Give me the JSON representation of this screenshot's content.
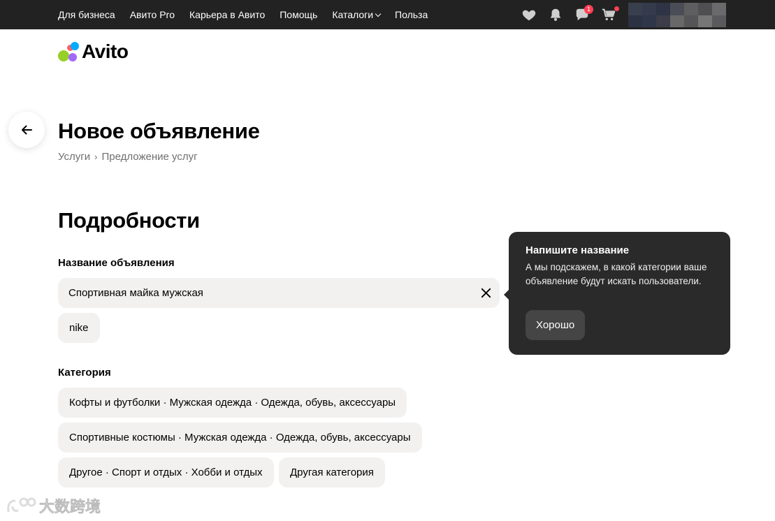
{
  "topnav": {
    "items": [
      "Для бизнеса",
      "Авито Pro",
      "Карьера в Авито",
      "Помощь",
      "Каталоги",
      "Польза"
    ],
    "messages_badge": "1",
    "icons": [
      "heart-icon",
      "bell-icon",
      "chat-icon",
      "cart-icon"
    ]
  },
  "logo": {
    "text": "Avito"
  },
  "page": {
    "title": "Новое объявление",
    "breadcrumb": [
      "Услуги",
      "Предложение услуг"
    ]
  },
  "details": {
    "section_title": "Подробности",
    "title_label": "Название объявления",
    "title_value": "Спортивная майка мужская",
    "suggestion": "nike",
    "category_label": "Категория",
    "categories": [
      "Кофты и футболки · Мужская одежда · Одежда, обувь, аксессуары",
      "Спортивные костюмы · Мужская одежда · Одежда, обувь, аксессуары",
      "Другое · Спорт и отдых · Хобби и отдых",
      "Другая категория"
    ]
  },
  "tooltip": {
    "title": "Напишите название",
    "text": "А мы подскажем, в какой категории ваше объявление будут искать пользователи.",
    "button": "Хорошо"
  },
  "watermark": {
    "text": "大数跨境"
  },
  "colors": {
    "topbar": "#222222",
    "chip_bg": "#f2f1f0",
    "tooltip_bg": "#2a2a2a",
    "badge": "#ff4053",
    "logo_dots": [
      "#97cf26",
      "#ff6163",
      "#a169f7",
      "#00aaff"
    ]
  }
}
